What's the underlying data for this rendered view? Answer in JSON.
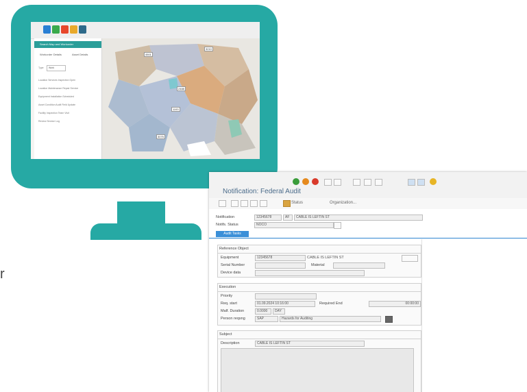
{
  "monitor": {
    "toolbar_colors": [
      "#2a7fd4",
      "#3aaa4c",
      "#e7472c",
      "#e8a92b",
      "#2e6a8a"
    ],
    "panel": {
      "header": "Search Map and Workorder",
      "tabs": [
        "Workorder Details",
        "Asset Details"
      ],
      "filter_label": "Type",
      "filter_value": "Work",
      "rows": [
        "Location Services Inspection Open",
        "Location Maintenance Repair Service",
        "Equipment Installation Scheduled",
        "Asset Condition Audit Field Update",
        "Facility Inspection Team Visit",
        "Review Service Log"
      ]
    },
    "map_labels": [
      "4501",
      "3210",
      "2488",
      "1193",
      "3075"
    ]
  },
  "sap": {
    "title": "Notification: Federal Audit",
    "toolbar": {
      "status_label": "Status",
      "organization_label": "Organization..."
    },
    "notification": {
      "label": "Notification",
      "number": "12345678",
      "type": "AF",
      "description": "CABLE IS LEFTIN ST"
    },
    "notif_status": {
      "label": "Notifs. Status",
      "value": "NOCO"
    },
    "tab_active": "Audit Tasks",
    "reference_object": {
      "title": "Reference Object",
      "equipment_label": "Equipment",
      "equipment_value": "12345678",
      "equipment_desc": "CABLE IS LEFTIN ST",
      "serial_label": "Serial Number",
      "material_label": "Material",
      "device_label": "Device data"
    },
    "execution": {
      "title": "Execution",
      "priority_label": "Priority",
      "req_start_label": "Req. start",
      "req_start_value": "01.09.2024 10:16:00",
      "req_end_label": "Required End",
      "req_end_value": "00:00:00",
      "malf_label": "Malf. Duration",
      "malf_value": "0.0000",
      "malf_unit": "DAY",
      "person_label": "Person reqsng",
      "person_code": "SAP",
      "person_name": "Hazards for Auditing"
    },
    "subject": {
      "title": "Subject",
      "description_label": "Description",
      "description_value": "CABLE IS LEFTIN ST"
    }
  },
  "fragment": {
    "left_letter": "r"
  }
}
